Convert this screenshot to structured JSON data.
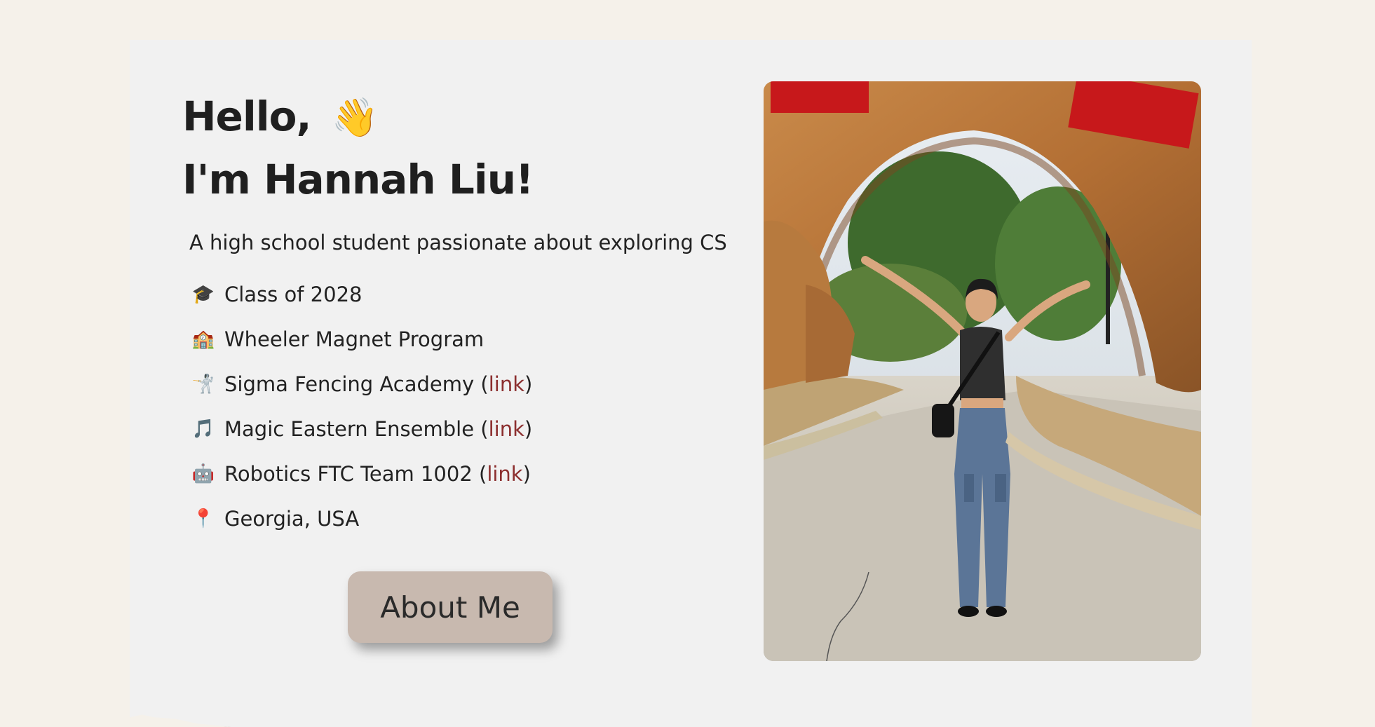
{
  "hero": {
    "greeting_line1": "Hello,",
    "wave_emoji": "👋",
    "greeting_line2": "I'm Hannah Liu!",
    "tagline": "A high school student passionate about exploring CS"
  },
  "facts": [
    {
      "icon": "graduation-cap-icon",
      "emoji": "🎓",
      "text": "Class of 2028",
      "link_label": ""
    },
    {
      "icon": "school-icon",
      "emoji": "🏫",
      "text": "Wheeler Magnet Program",
      "link_label": ""
    },
    {
      "icon": "fencing-icon",
      "emoji": "🤺",
      "text": "Sigma Fencing Academy",
      "link_label": "link"
    },
    {
      "icon": "music-note-icon",
      "emoji": "🎵",
      "text": "Magic Eastern Ensemble",
      "link_label": "link"
    },
    {
      "icon": "robot-icon",
      "emoji": "🤖",
      "text": "Robotics FTC Team 1002",
      "link_label": "link"
    },
    {
      "icon": "pin-icon",
      "emoji": "📍",
      "text": "Georgia, USA",
      "link_label": ""
    }
  ],
  "cta": {
    "about_label": "About Me"
  },
  "photo": {
    "alt": "Portrait photo"
  },
  "colors": {
    "background": "#f5f1ea",
    "card": "#f1f1f1",
    "link": "#8c2f2f",
    "button": "#c8b9af"
  }
}
